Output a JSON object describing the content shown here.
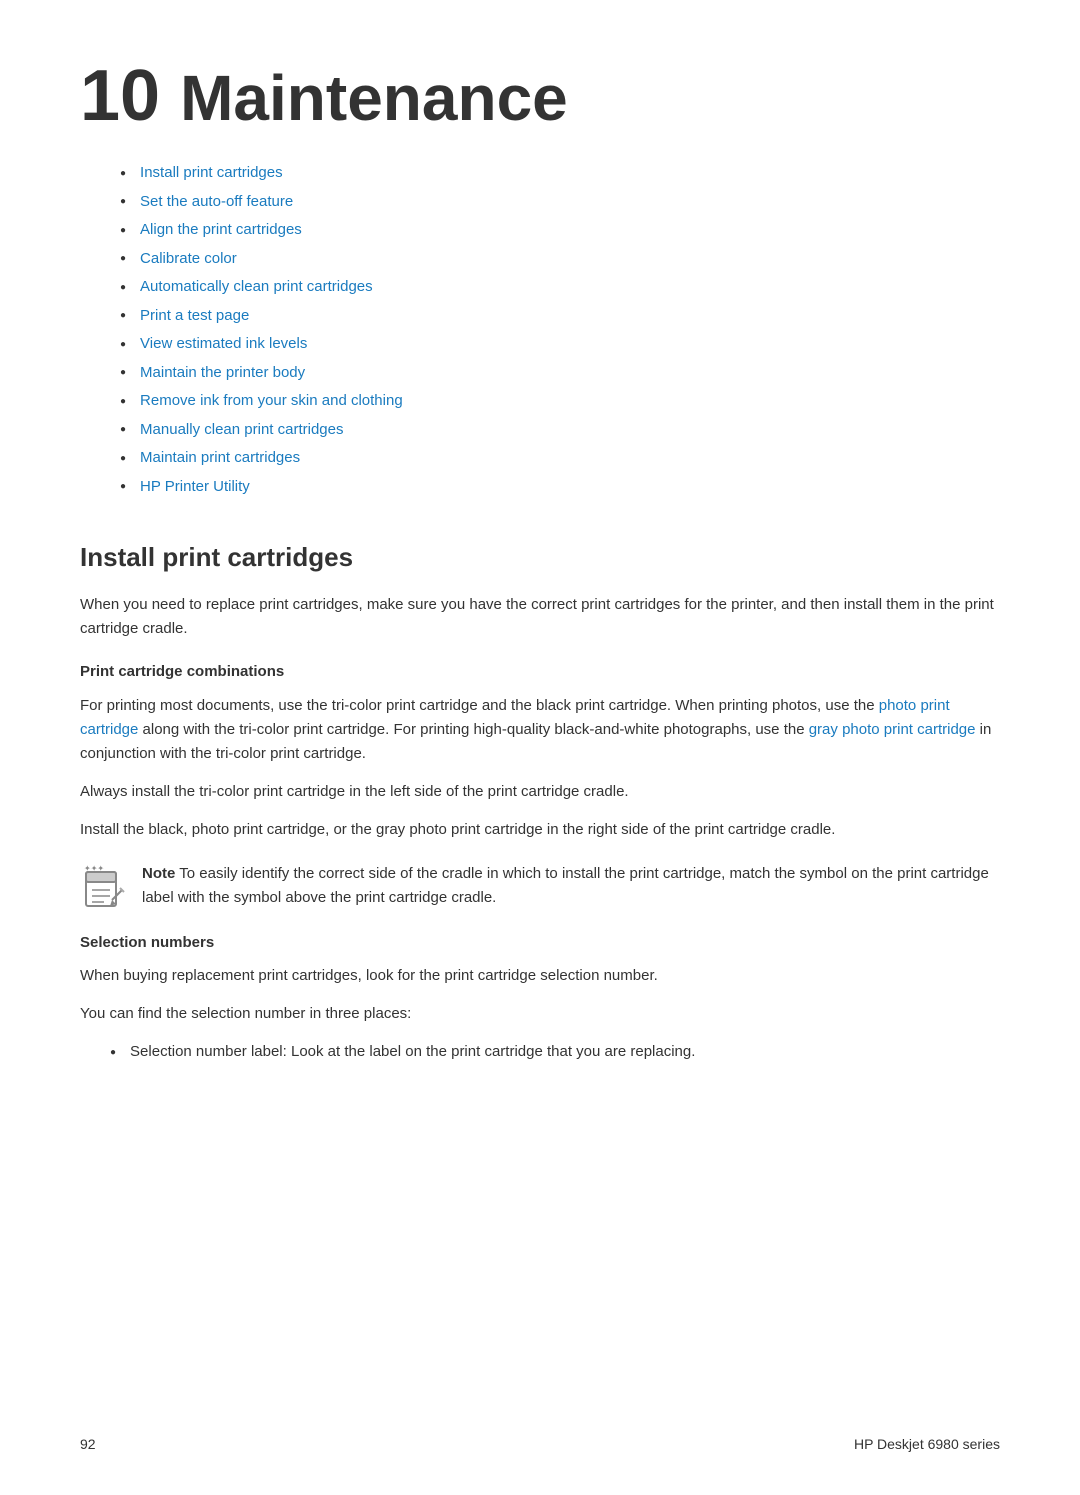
{
  "chapter": {
    "number": "10",
    "title": "Maintenance"
  },
  "toc": {
    "items": [
      {
        "label": "Install print cartridges",
        "id": "install"
      },
      {
        "label": "Set the auto-off feature",
        "id": "autooff"
      },
      {
        "label": "Align the print cartridges",
        "id": "align"
      },
      {
        "label": "Calibrate color",
        "id": "calibrate"
      },
      {
        "label": "Automatically clean print cartridges",
        "id": "autoclean"
      },
      {
        "label": "Print a test page",
        "id": "testpage"
      },
      {
        "label": "View estimated ink levels",
        "id": "inklevels"
      },
      {
        "label": "Maintain the printer body",
        "id": "printerbody"
      },
      {
        "label": "Remove ink from your skin and clothing",
        "id": "removeink"
      },
      {
        "label": "Manually clean print cartridges",
        "id": "manualclean"
      },
      {
        "label": "Maintain print cartridges",
        "id": "maintaincartridges"
      },
      {
        "label": "HP Printer Utility",
        "id": "hputility"
      }
    ]
  },
  "section": {
    "title": "Install print cartridges",
    "intro": "When you need to replace print cartridges, make sure you have the correct print cartridges for the printer, and then install them in the print cartridge cradle.",
    "print_cartridge_combinations": {
      "heading": "Print cartridge combinations",
      "paragraph1_prefix": "For printing most documents, use the tri-color print cartridge and the black print cartridge. When printing photos, use the ",
      "link1_text": "photo print cartridge",
      "paragraph1_middle": " along with the tri-color print cartridge. For printing high-quality black-and-white photographs, use the ",
      "link2_text": "gray photo print cartridge",
      "paragraph1_suffix": " in conjunction with the tri-color print cartridge.",
      "paragraph2": "Always install the tri-color print cartridge in the left side of the print cartridge cradle.",
      "paragraph3": "Install the black, photo print cartridge, or the gray photo print cartridge in the right side of the print cartridge cradle.",
      "note_label": "Note",
      "note_text": "To easily identify the correct side of the cradle in which to install the print cartridge, match the symbol on the print cartridge label with the symbol above the print cartridge cradle."
    },
    "selection_numbers": {
      "heading": "Selection numbers",
      "paragraph1": "When buying replacement print cartridges, look for the print cartridge selection number.",
      "paragraph2": "You can find the selection number in three places:",
      "bullets": [
        "Selection number label: Look at the label on the print cartridge that you are replacing."
      ]
    }
  },
  "footer": {
    "page_number": "92",
    "product_name": "HP Deskjet 6980 series"
  }
}
